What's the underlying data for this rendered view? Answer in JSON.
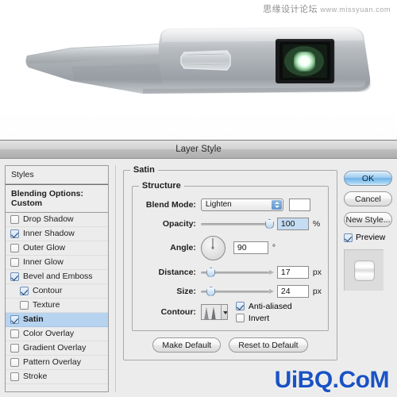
{
  "photo": {
    "watermark_cn": "思缘设计论坛",
    "watermark_url": "www.missyuan.com",
    "device_alt": "brushed-metal-device"
  },
  "dialog": {
    "title": "Layer Style",
    "styles_panel": {
      "header": "Styles",
      "blending_options": "Blending Options: Custom",
      "items": [
        {
          "label": "Drop Shadow",
          "checked": false,
          "indent": false,
          "selected": false
        },
        {
          "label": "Inner Shadow",
          "checked": true,
          "indent": false,
          "selected": false
        },
        {
          "label": "Outer Glow",
          "checked": false,
          "indent": false,
          "selected": false
        },
        {
          "label": "Inner Glow",
          "checked": false,
          "indent": false,
          "selected": false
        },
        {
          "label": "Bevel and Emboss",
          "checked": true,
          "indent": false,
          "selected": false
        },
        {
          "label": "Contour",
          "checked": true,
          "indent": true,
          "selected": false
        },
        {
          "label": "Texture",
          "checked": false,
          "indent": true,
          "selected": false
        },
        {
          "label": "Satin",
          "checked": true,
          "indent": false,
          "selected": true
        },
        {
          "label": "Color Overlay",
          "checked": false,
          "indent": false,
          "selected": false
        },
        {
          "label": "Gradient Overlay",
          "checked": false,
          "indent": false,
          "selected": false
        },
        {
          "label": "Pattern Overlay",
          "checked": false,
          "indent": false,
          "selected": false
        },
        {
          "label": "Stroke",
          "checked": false,
          "indent": false,
          "selected": false
        }
      ]
    },
    "satin": {
      "legend": "Satin",
      "structure_legend": "Structure",
      "blend_mode": {
        "label": "Blend Mode:",
        "value": "Lighten",
        "swatch_color": "#ffffff"
      },
      "opacity": {
        "label": "Opacity:",
        "value": "100",
        "unit": "%",
        "percent": 100
      },
      "angle": {
        "label": "Angle:",
        "value": "90",
        "unit": "°",
        "degrees": 90
      },
      "distance": {
        "label": "Distance:",
        "value": "17",
        "unit": "px",
        "percent": 9
      },
      "size": {
        "label": "Size:",
        "value": "24",
        "unit": "px",
        "percent": 9
      },
      "contour": {
        "label": "Contour:",
        "thumb": "contour-curve-double-peak"
      },
      "anti_aliased": {
        "label": "Anti-aliased",
        "checked": true
      },
      "invert": {
        "label": "Invert",
        "checked": false
      },
      "make_default": "Make Default",
      "reset_to_default": "Reset to Default"
    },
    "buttons": {
      "ok": "OK",
      "cancel": "Cancel",
      "new_style": "New Style...",
      "preview": {
        "label": "Preview",
        "checked": true
      }
    }
  },
  "footer": {
    "watermark": "UiBQ.CoM",
    "watermark_color": "#1a52c4"
  }
}
